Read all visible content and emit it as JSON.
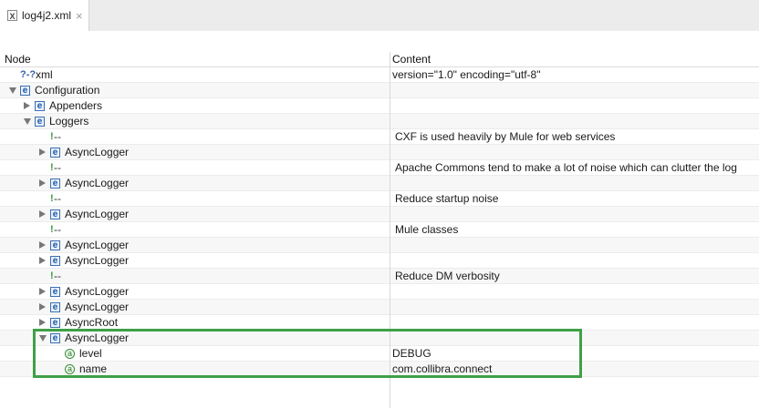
{
  "tab": {
    "label": "log4j2.xml",
    "close": "×",
    "icon": "xml-file-icon"
  },
  "columns": {
    "node": "Node",
    "content": "Content"
  },
  "rows": [
    {
      "type": "pi",
      "label": "xml",
      "content": "version=\"1.0\" encoding=\"utf-8\""
    },
    {
      "type": "element",
      "label": "Configuration",
      "content": ""
    },
    {
      "type": "element",
      "label": "Appenders",
      "content": ""
    },
    {
      "type": "element",
      "label": "Loggers",
      "content": ""
    },
    {
      "type": "comment",
      "label": "--",
      "content": "CXF is used heavily by Mule for web services"
    },
    {
      "type": "element",
      "label": "AsyncLogger",
      "content": ""
    },
    {
      "type": "comment",
      "label": "--",
      "content": "Apache Commons tend to make a lot of noise which can clutter the log"
    },
    {
      "type": "element",
      "label": "AsyncLogger",
      "content": ""
    },
    {
      "type": "comment",
      "label": "--",
      "content": "Reduce startup noise"
    },
    {
      "type": "element",
      "label": "AsyncLogger",
      "content": ""
    },
    {
      "type": "comment",
      "label": "--",
      "content": "Mule classes"
    },
    {
      "type": "element",
      "label": "AsyncLogger",
      "content": ""
    },
    {
      "type": "element",
      "label": "AsyncLogger",
      "content": ""
    },
    {
      "type": "comment",
      "label": "--",
      "content": "Reduce DM verbosity"
    },
    {
      "type": "element",
      "label": "AsyncLogger",
      "content": ""
    },
    {
      "type": "element",
      "label": "AsyncLogger",
      "content": ""
    },
    {
      "type": "element",
      "label": "AsyncRoot",
      "content": ""
    },
    {
      "type": "element",
      "label": "AsyncLogger",
      "content": ""
    },
    {
      "type": "attribute",
      "label": "level",
      "content": "DEBUG"
    },
    {
      "type": "attribute",
      "label": "name",
      "content": "com.collibra.connect"
    }
  ],
  "icons": {
    "pi": "?-?",
    "element": "e",
    "attribute": "a",
    "comment": "!"
  },
  "colors": {
    "highlight": "#3fa046",
    "element_icon": "#1d57a8",
    "comment_icon": "#3a9a3a"
  }
}
